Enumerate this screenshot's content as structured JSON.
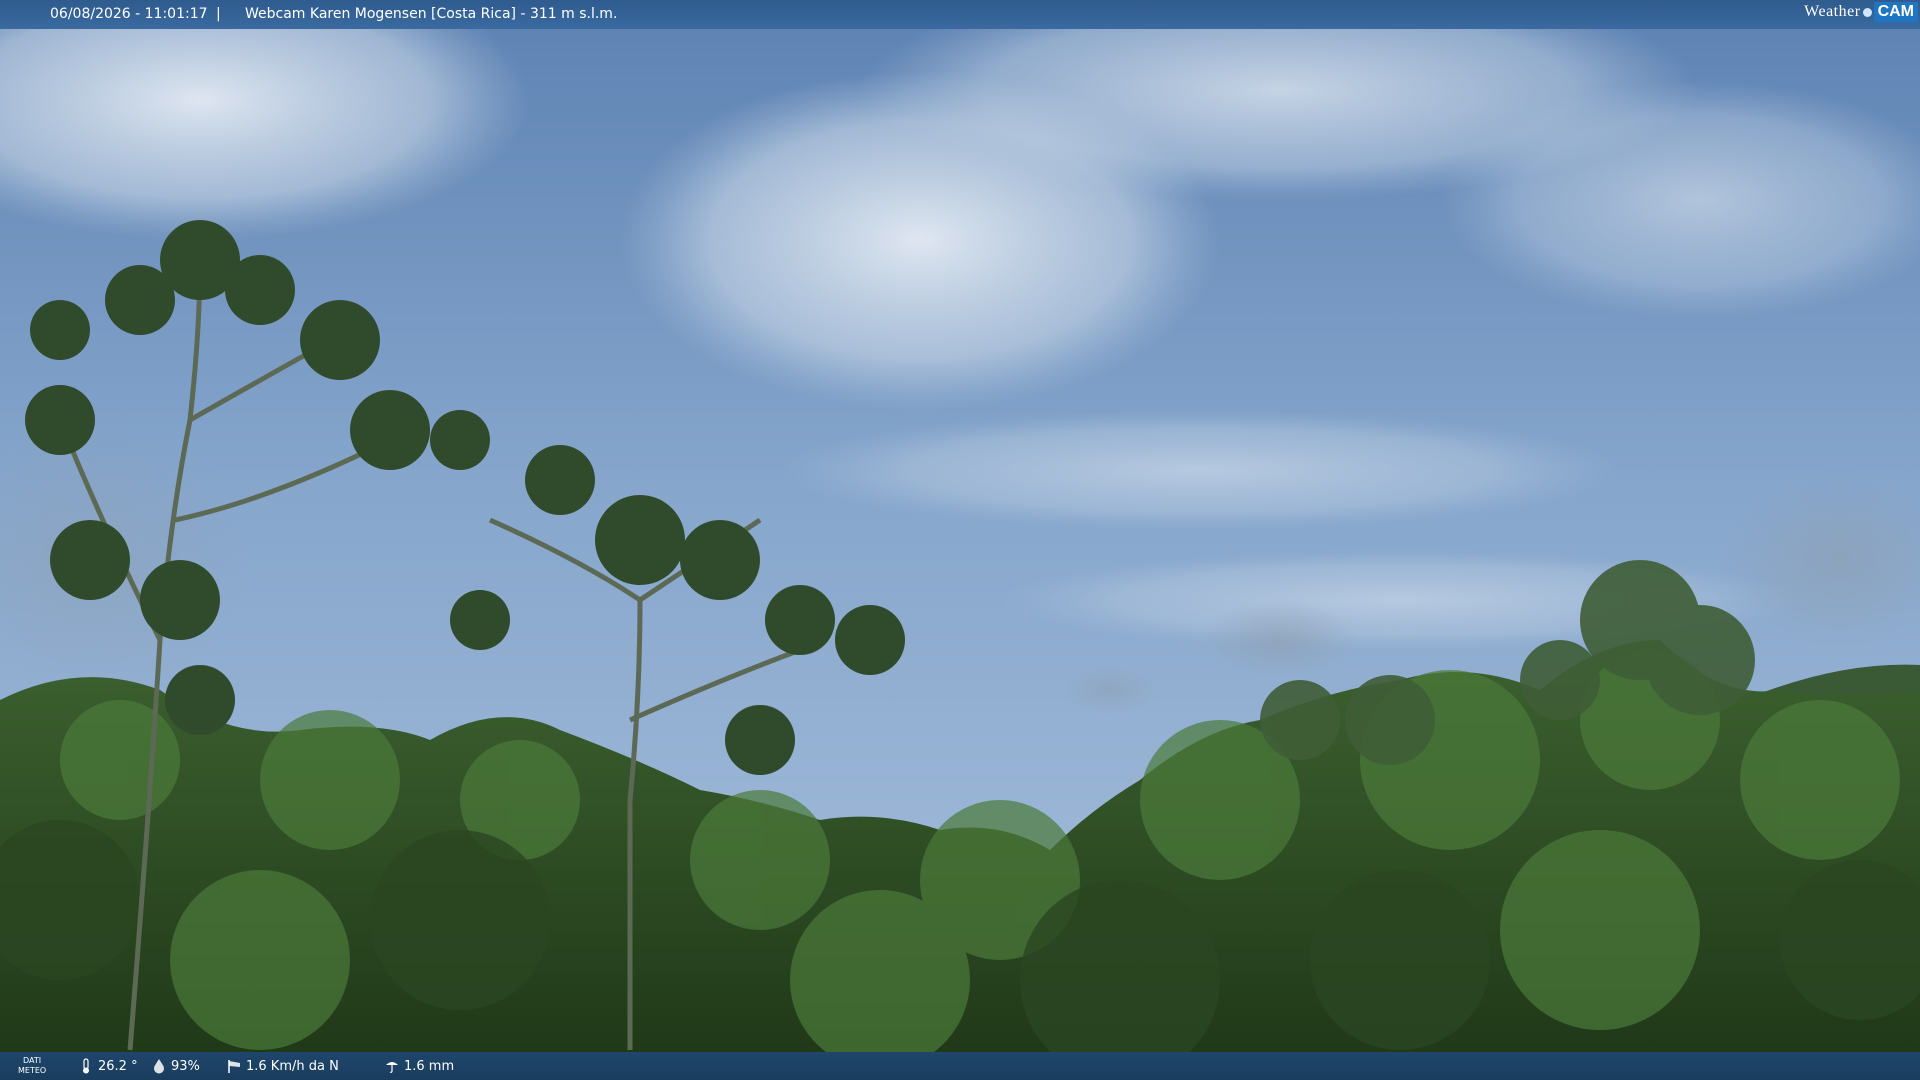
{
  "header": {
    "timestamp": "06/08/2026 - 11:01:17",
    "separator": "|",
    "title": "Webcam Karen Mogensen [Costa Rica]  - 311 m s.l.m.",
    "logo_left": "Weather",
    "logo_right": "CAM"
  },
  "footer": {
    "label_line1": "DATI",
    "label_line2": "METEO",
    "temperature": "26.2 °",
    "humidity": "93%",
    "wind": "1.6 Km/h da N",
    "rain": "1.6 mm"
  },
  "icons": {
    "temperature": "thermometer-icon",
    "humidity": "humidity-drop-icon",
    "wind": "wind-sock-icon",
    "rain": "rain-icon"
  },
  "colors": {
    "topbar": "#3a6aa0",
    "bottombar": "#1e466b",
    "sky": "#7e9ec6",
    "forest": "#2c4a24"
  }
}
